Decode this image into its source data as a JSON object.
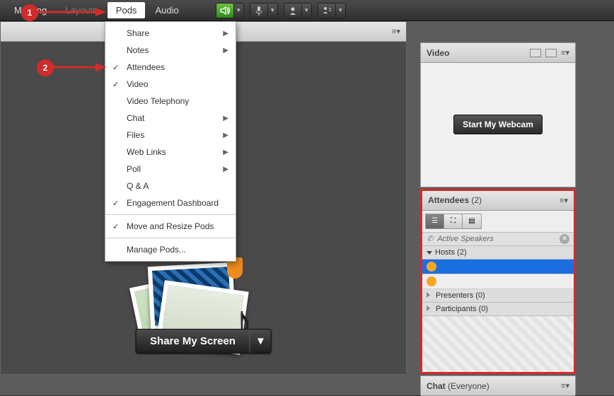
{
  "menubar": {
    "items": [
      "Meeting",
      "Layouts",
      "Pods",
      "Audio"
    ],
    "open_index": 2
  },
  "dropdown": {
    "groups": [
      [
        {
          "label": "Share",
          "submenu": true,
          "checked": false
        },
        {
          "label": "Notes",
          "submenu": true,
          "checked": false
        },
        {
          "label": "Attendees",
          "submenu": false,
          "checked": true
        },
        {
          "label": "Video",
          "submenu": false,
          "checked": true
        },
        {
          "label": "Video Telephony",
          "submenu": false,
          "checked": false
        },
        {
          "label": "Chat",
          "submenu": true,
          "checked": false
        },
        {
          "label": "Files",
          "submenu": true,
          "checked": false
        },
        {
          "label": "Web Links",
          "submenu": true,
          "checked": false
        },
        {
          "label": "Poll",
          "submenu": true,
          "checked": false
        },
        {
          "label": "Q & A",
          "submenu": false,
          "checked": false
        },
        {
          "label": "Engagement Dashboard",
          "submenu": false,
          "checked": true
        }
      ],
      [
        {
          "label": "Move and Resize Pods",
          "submenu": false,
          "checked": true
        }
      ],
      [
        {
          "label": "Manage Pods...",
          "submenu": false,
          "checked": false
        }
      ]
    ]
  },
  "share": {
    "button_label": "Share My Screen"
  },
  "video": {
    "title": "Video",
    "button_label": "Start My Webcam"
  },
  "attendees": {
    "title": "Attendees",
    "count": "(2)",
    "active_speakers_label": "Active Speakers",
    "groups": [
      {
        "label": "Hosts (2)",
        "expanded": true,
        "rows": [
          {
            "selected": true,
            "name": ""
          },
          {
            "selected": false,
            "name": ""
          }
        ]
      },
      {
        "label": "Presenters (0)",
        "expanded": false,
        "rows": []
      },
      {
        "label": "Participants (0)",
        "expanded": false,
        "rows": []
      }
    ]
  },
  "chat": {
    "title": "Chat",
    "scope": "(Everyone)"
  },
  "annotations": {
    "badge1": "1",
    "badge2": "2"
  }
}
